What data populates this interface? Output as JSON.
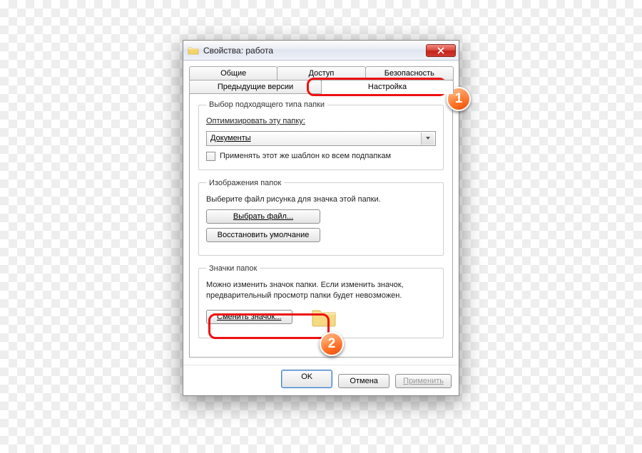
{
  "title": "Свойства: работа",
  "tabs": {
    "row1": [
      "Общие",
      "Доступ",
      "Безопасность"
    ],
    "row2": [
      "Предыдущие версии",
      "Настройка"
    ],
    "active": "Настройка"
  },
  "group1": {
    "legend": "Выбор подходящего типа папки",
    "optimize_label": "Оптимизировать эту папку:",
    "select_value": "Документы",
    "apply_sub_label": "Применять этот же шаблон ко всем подпапкам"
  },
  "group2": {
    "legend": "Изображения папок",
    "desc": "Выберите файл рисунка для значка этой папки.",
    "choose_btn": "Выбрать файл...",
    "restore_btn": "Восстановить умолчание"
  },
  "group3": {
    "legend": "Значки папок",
    "desc": "Можно изменить значок папки. Если изменить значок, предварительный просмотр папки будет невозможен.",
    "change_btn": "Сменить значок..."
  },
  "buttons": {
    "ok": "OK",
    "cancel": "Отмена",
    "apply": "Применить"
  },
  "annotations": {
    "one": "1",
    "two": "2"
  }
}
